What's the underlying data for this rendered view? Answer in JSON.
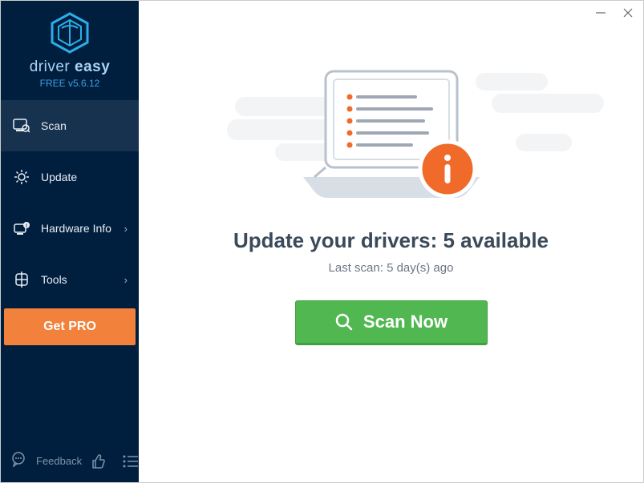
{
  "brand": {
    "name_light": "driver ",
    "name_bold": "easy",
    "version": "FREE v5.6.12"
  },
  "sidebar": {
    "items": [
      {
        "label": "Scan",
        "icon": "scan",
        "has_sub": false,
        "selected": true
      },
      {
        "label": "Update",
        "icon": "gear",
        "has_sub": false,
        "selected": false
      },
      {
        "label": "Hardware Info",
        "icon": "hardware",
        "has_sub": true,
        "selected": false
      },
      {
        "label": "Tools",
        "icon": "tools",
        "has_sub": true,
        "selected": false
      }
    ],
    "get_pro": "Get PRO",
    "feedback": "Feedback"
  },
  "main": {
    "headline": "Update your drivers: 5 available",
    "subline": "Last scan: 5 day(s) ago",
    "cta": "Scan Now"
  },
  "colors": {
    "accent_orange": "#f1813b",
    "accent_green": "#51b851",
    "info_orange": "#f06a2a"
  }
}
